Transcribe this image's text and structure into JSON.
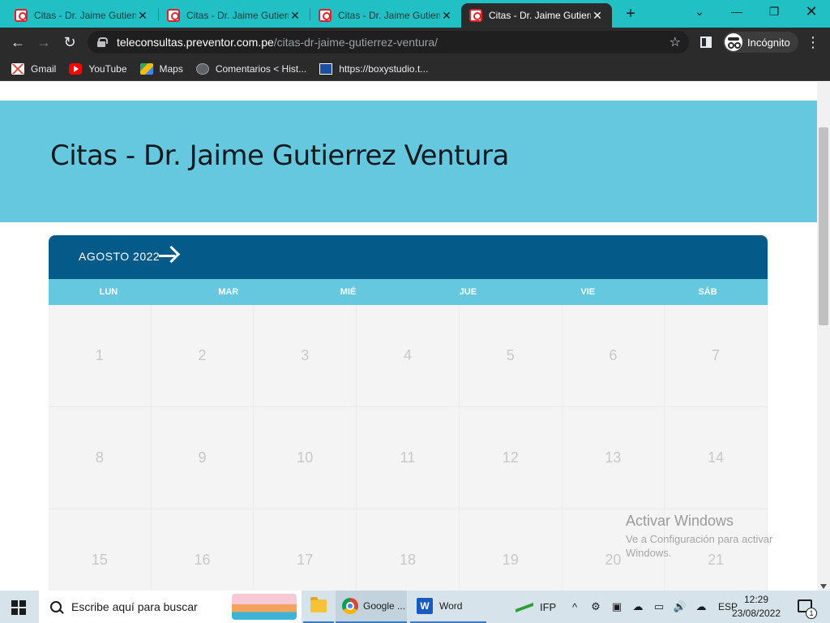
{
  "browser": {
    "tabs": [
      {
        "title": "Citas - Dr. Jaime Gutierrez Ventura",
        "active": false
      },
      {
        "title": "Citas - Dr. Jaime Gutierrez Ventura",
        "active": false
      },
      {
        "title": "Citas - Dr. Jaime Gutierrez Ventura",
        "active": false
      },
      {
        "title": "Citas - Dr. Jaime Gutierrez Ventura",
        "active": true
      }
    ],
    "url_host": "teleconsultas.preventor.com.pe",
    "url_path": "/citas-dr-jaime-gutierrez-ventura/",
    "incognito_label": "Incógnito",
    "bookmarks": [
      "Gmail",
      "YouTube",
      "Maps",
      "Comentarios < Hist...",
      "https://boxystudio.t..."
    ]
  },
  "page": {
    "title": "Citas - Dr. Jaime Gutierrez Ventura",
    "calendar": {
      "month_label": "AGOSTO 2022",
      "weekdays": [
        "LUN",
        "MAR",
        "MIÉ",
        "JUE",
        "VIE",
        "SÁB"
      ],
      "days": [
        [
          "1",
          "2",
          "3",
          "4",
          "5",
          "6",
          "7"
        ],
        [
          "8",
          "9",
          "10",
          "11",
          "12",
          "13",
          "14"
        ],
        [
          "15",
          "16",
          "17",
          "18",
          "19",
          "20",
          "21"
        ]
      ]
    },
    "watermark": {
      "title": "Activar Windows",
      "line1": "Ve a Configuración para activar",
      "line2": "Windows."
    }
  },
  "taskbar": {
    "search_placeholder": "Escribe aquí para buscar",
    "chrome_label": "Google ...",
    "word_label": "Word",
    "ifp_label": "IFP",
    "language": "ESP",
    "time": "12:29",
    "date": "23/08/2022",
    "notification_count": "1"
  },
  "colors": {
    "tabstrip": "#20c0c4",
    "banner": "#65c8df",
    "calendar_header": "#045b8a",
    "weekday_bar": "#65c8df"
  }
}
